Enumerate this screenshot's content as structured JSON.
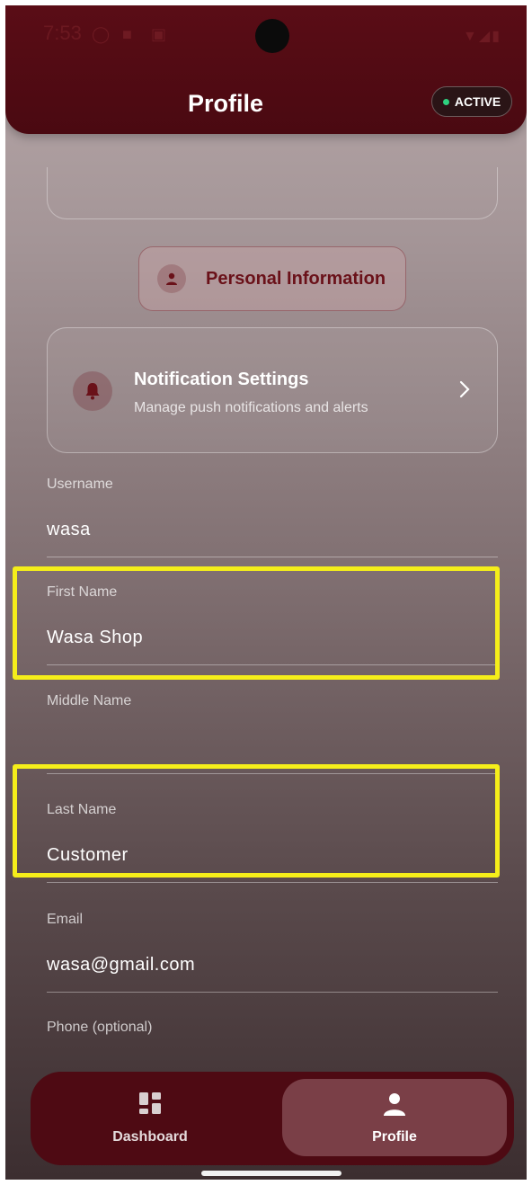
{
  "status_bar": {
    "time": "7:53"
  },
  "header": {
    "title": "Profile",
    "status_badge": "ACTIVE"
  },
  "section": {
    "label": "Personal Information"
  },
  "notification_card": {
    "title": "Notification Settings",
    "subtitle": "Manage push notifications and alerts"
  },
  "fields": {
    "username": {
      "label": "Username",
      "value": "wasa"
    },
    "first_name": {
      "label": "First Name",
      "value": "Wasa Shop"
    },
    "middle_name": {
      "label": "Middle Name",
      "value": ""
    },
    "last_name": {
      "label": "Last Name",
      "value": "Customer"
    },
    "email": {
      "label": "Email",
      "value": "wasa@gmail.com"
    },
    "phone": {
      "label": "Phone (optional)",
      "value": ""
    }
  },
  "nav": {
    "dashboard": "Dashboard",
    "profile": "Profile"
  },
  "colors": {
    "header_bg": "#5a0d16",
    "accent": "#6a1119",
    "active_dot": "#2ed17f",
    "highlight": "#f5ee1a",
    "nav_selected": "#7a3f47"
  }
}
